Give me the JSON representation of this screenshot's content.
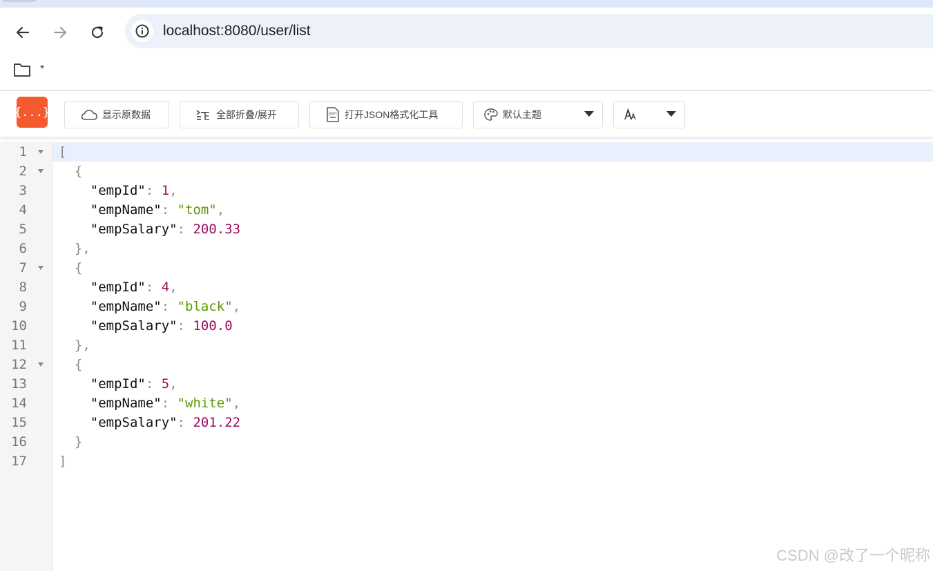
{
  "browser": {
    "url_host": "localhost",
    "url_rest": ":8080/user/list",
    "bookmark_label": "*"
  },
  "toolbar": {
    "logo_text": "{...}",
    "raw_label": "显示原数据",
    "fold_label": "全部折叠/展开",
    "formatter_label": "打开JSON格式化工具",
    "theme_label": "默认主题",
    "font_label": "AA"
  },
  "json_view": {
    "lines": [
      {
        "n": "1",
        "fold": true,
        "tokens": [
          {
            "t": "[",
            "c": "pn"
          }
        ]
      },
      {
        "n": "2",
        "fold": true,
        "tokens": [
          {
            "t": "  {",
            "c": "pn"
          }
        ]
      },
      {
        "n": "3",
        "fold": false,
        "tokens": [
          {
            "t": "    \"empId\"",
            "c": "key"
          },
          {
            "t": ": ",
            "c": "pn"
          },
          {
            "t": "1",
            "c": "num"
          },
          {
            "t": ",",
            "c": "pn"
          }
        ]
      },
      {
        "n": "4",
        "fold": false,
        "tokens": [
          {
            "t": "    \"empName\"",
            "c": "key"
          },
          {
            "t": ": ",
            "c": "pn"
          },
          {
            "t": "\"tom\"",
            "c": "str"
          },
          {
            "t": ",",
            "c": "pn"
          }
        ]
      },
      {
        "n": "5",
        "fold": false,
        "tokens": [
          {
            "t": "    \"empSalary\"",
            "c": "key"
          },
          {
            "t": ": ",
            "c": "pn"
          },
          {
            "t": "200.33",
            "c": "num"
          }
        ]
      },
      {
        "n": "6",
        "fold": false,
        "tokens": [
          {
            "t": "  },",
            "c": "pn"
          }
        ]
      },
      {
        "n": "7",
        "fold": true,
        "tokens": [
          {
            "t": "  {",
            "c": "pn"
          }
        ]
      },
      {
        "n": "8",
        "fold": false,
        "tokens": [
          {
            "t": "    \"empId\"",
            "c": "key"
          },
          {
            "t": ": ",
            "c": "pn"
          },
          {
            "t": "4",
            "c": "num"
          },
          {
            "t": ",",
            "c": "pn"
          }
        ]
      },
      {
        "n": "9",
        "fold": false,
        "tokens": [
          {
            "t": "    \"empName\"",
            "c": "key"
          },
          {
            "t": ": ",
            "c": "pn"
          },
          {
            "t": "\"black\"",
            "c": "str"
          },
          {
            "t": ",",
            "c": "pn"
          }
        ]
      },
      {
        "n": "10",
        "fold": false,
        "tokens": [
          {
            "t": "    \"empSalary\"",
            "c": "key"
          },
          {
            "t": ": ",
            "c": "pn"
          },
          {
            "t": "100.0",
            "c": "num"
          }
        ]
      },
      {
        "n": "11",
        "fold": false,
        "tokens": [
          {
            "t": "  },",
            "c": "pn"
          }
        ]
      },
      {
        "n": "12",
        "fold": true,
        "tokens": [
          {
            "t": "  {",
            "c": "pn"
          }
        ]
      },
      {
        "n": "13",
        "fold": false,
        "tokens": [
          {
            "t": "    \"empId\"",
            "c": "key"
          },
          {
            "t": ": ",
            "c": "pn"
          },
          {
            "t": "5",
            "c": "num"
          },
          {
            "t": ",",
            "c": "pn"
          }
        ]
      },
      {
        "n": "14",
        "fold": false,
        "tokens": [
          {
            "t": "    \"empName\"",
            "c": "key"
          },
          {
            "t": ": ",
            "c": "pn"
          },
          {
            "t": "\"white\"",
            "c": "str"
          },
          {
            "t": ",",
            "c": "pn"
          }
        ]
      },
      {
        "n": "15",
        "fold": false,
        "tokens": [
          {
            "t": "    \"empSalary\"",
            "c": "key"
          },
          {
            "t": ": ",
            "c": "pn"
          },
          {
            "t": "201.22",
            "c": "num"
          }
        ]
      },
      {
        "n": "16",
        "fold": false,
        "tokens": [
          {
            "t": "  }",
            "c": "pn"
          }
        ]
      },
      {
        "n": "17",
        "fold": false,
        "tokens": [
          {
            "t": "]",
            "c": "pn"
          }
        ]
      }
    ]
  },
  "watermark": "CSDN @改了一个昵称",
  "colors": {
    "logo": "#f45a2e",
    "key": "#111111",
    "number": "#9a0d5e",
    "string": "#5a9a00",
    "punctuation": "#8a8a8a",
    "active_line": "#e8f0fe"
  },
  "icons": [
    "back-arrow-icon",
    "forward-arrow-icon",
    "reload-icon",
    "site-info-icon",
    "folder-icon",
    "cloud-icon",
    "collapse-list-icon",
    "json-file-icon",
    "palette-icon",
    "font-size-icon",
    "chevron-down-icon",
    "fold-arrow-icon"
  ]
}
